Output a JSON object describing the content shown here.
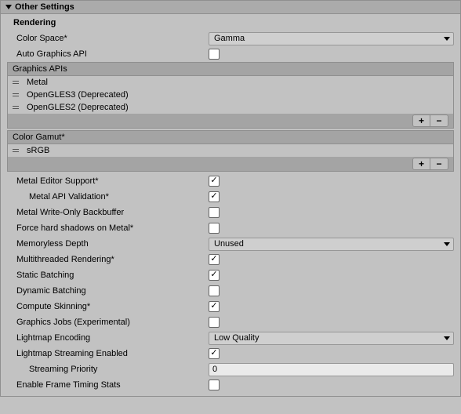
{
  "section": {
    "title": "Other Settings"
  },
  "rendering": {
    "title": "Rendering",
    "colorSpace": {
      "label": "Color Space*",
      "value": "Gamma"
    },
    "autoGraphicsAPI": {
      "label": "Auto Graphics API",
      "checked": false
    },
    "graphicsAPIs": {
      "label": "Graphics APIs",
      "items": [
        "Metal",
        "OpenGLES3 (Deprecated)",
        "OpenGLES2 (Deprecated)"
      ]
    },
    "colorGamut": {
      "label": "Color Gamut*",
      "items": [
        "sRGB"
      ]
    },
    "metalEditorSupport": {
      "label": "Metal Editor Support*",
      "checked": true
    },
    "metalAPIValidation": {
      "label": "Metal API Validation*",
      "checked": true
    },
    "metalWriteOnlyBackbuffer": {
      "label": "Metal Write-Only Backbuffer",
      "checked": false
    },
    "forceHardShadowsOnMetal": {
      "label": "Force hard shadows on Metal*",
      "checked": false
    },
    "memorylessDepth": {
      "label": "Memoryless Depth",
      "value": "Unused"
    },
    "multithreadedRendering": {
      "label": "Multithreaded Rendering*",
      "checked": true
    },
    "staticBatching": {
      "label": "Static Batching",
      "checked": true
    },
    "dynamicBatching": {
      "label": "Dynamic Batching",
      "checked": false
    },
    "computeSkinning": {
      "label": "Compute Skinning*",
      "checked": true
    },
    "graphicsJobs": {
      "label": "Graphics Jobs (Experimental)",
      "checked": false
    },
    "lightmapEncoding": {
      "label": "Lightmap Encoding",
      "value": "Low Quality"
    },
    "lightmapStreamingEnabled": {
      "label": "Lightmap Streaming Enabled",
      "checked": true
    },
    "streamingPriority": {
      "label": "Streaming Priority",
      "value": "0"
    },
    "enableFrameTimingStats": {
      "label": "Enable Frame Timing Stats",
      "checked": false
    }
  },
  "buttons": {
    "plus": "+",
    "minus": "−"
  }
}
